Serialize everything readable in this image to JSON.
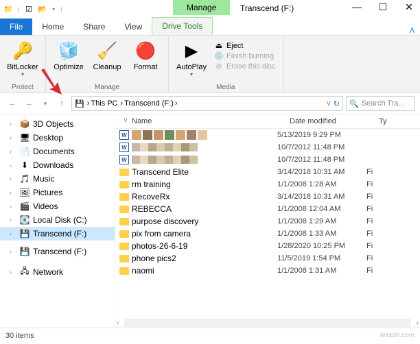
{
  "window": {
    "title": "Transcend (F:)",
    "manage_tab": "Manage"
  },
  "tabs": {
    "file": "File",
    "home": "Home",
    "share": "Share",
    "view": "View",
    "drive_tools": "Drive Tools"
  },
  "ribbon": {
    "protect": {
      "label": "Protect",
      "bitlocker": "BitLocker"
    },
    "manage": {
      "label": "Manage",
      "optimize": "Optimize",
      "cleanup": "Cleanup",
      "format": "Format"
    },
    "media": {
      "label": "Media",
      "autoplay": "AutoPlay",
      "eject": "Eject",
      "finish_burning": "Finish burning",
      "erase": "Erase this disc"
    }
  },
  "address": {
    "this_pc": "This PC",
    "current": "Transcend (F:)"
  },
  "search": {
    "placeholder": "Search Tra..."
  },
  "nav_items": [
    {
      "label": "3D Objects",
      "icon": "📦"
    },
    {
      "label": "Desktop",
      "icon": "🖥"
    },
    {
      "label": "Documents",
      "icon": "📄"
    },
    {
      "label": "Downloads",
      "icon": "⬇"
    },
    {
      "label": "Music",
      "icon": "🎵"
    },
    {
      "label": "Pictures",
      "icon": "🖼"
    },
    {
      "label": "Videos",
      "icon": "🎬"
    },
    {
      "label": "Local Disk (C:)",
      "icon": "💽"
    },
    {
      "label": "Transcend (F:)",
      "icon": "💾",
      "selected": true
    },
    {
      "label": "Transcend (F:)",
      "icon": "💾",
      "top": true
    },
    {
      "label": "Network",
      "icon": "🖧",
      "top": true
    }
  ],
  "columns": {
    "name": "Name",
    "date": "Date modified",
    "type": "Ty"
  },
  "files": [
    {
      "type": "doc",
      "name": "",
      "date": "5/13/2019 9:29 PM",
      "t": ""
    },
    {
      "type": "doc",
      "name": "",
      "date": "10/7/2012 11:48 PM",
      "t": ""
    },
    {
      "type": "doc",
      "name": "",
      "date": "10/7/2012 11:48 PM",
      "t": ""
    },
    {
      "type": "folder",
      "name": "Transcend Elite",
      "date": "3/14/2018 10:31 AM",
      "t": "Fi"
    },
    {
      "type": "folder",
      "name": "rm training",
      "date": "1/1/2008 1:28 AM",
      "t": "Fi"
    },
    {
      "type": "folder",
      "name": "RecoveRx",
      "date": "3/14/2018 10:31 AM",
      "t": "Fi"
    },
    {
      "type": "folder",
      "name": "REBECCA",
      "date": "1/1/2008 12:04 AM",
      "t": "Fi"
    },
    {
      "type": "folder",
      "name": "purpose discovery",
      "date": "1/1/2008 1:29 AM",
      "t": "Fi"
    },
    {
      "type": "folder",
      "name": "pix from camera",
      "date": "1/1/2008 1:33 AM",
      "t": "Fi"
    },
    {
      "type": "folder",
      "name": "photos-26-6-19",
      "date": "1/28/2020 10:25 PM",
      "t": "Fi"
    },
    {
      "type": "folder",
      "name": "phone pics2",
      "date": "11/5/2019 1:54 PM",
      "t": "Fi"
    },
    {
      "type": "folder",
      "name": "naomi",
      "date": "1/1/2008 1:31 AM",
      "t": "Fi"
    }
  ],
  "status": {
    "count": "30 items",
    "watermark": "wsxdn.com"
  }
}
